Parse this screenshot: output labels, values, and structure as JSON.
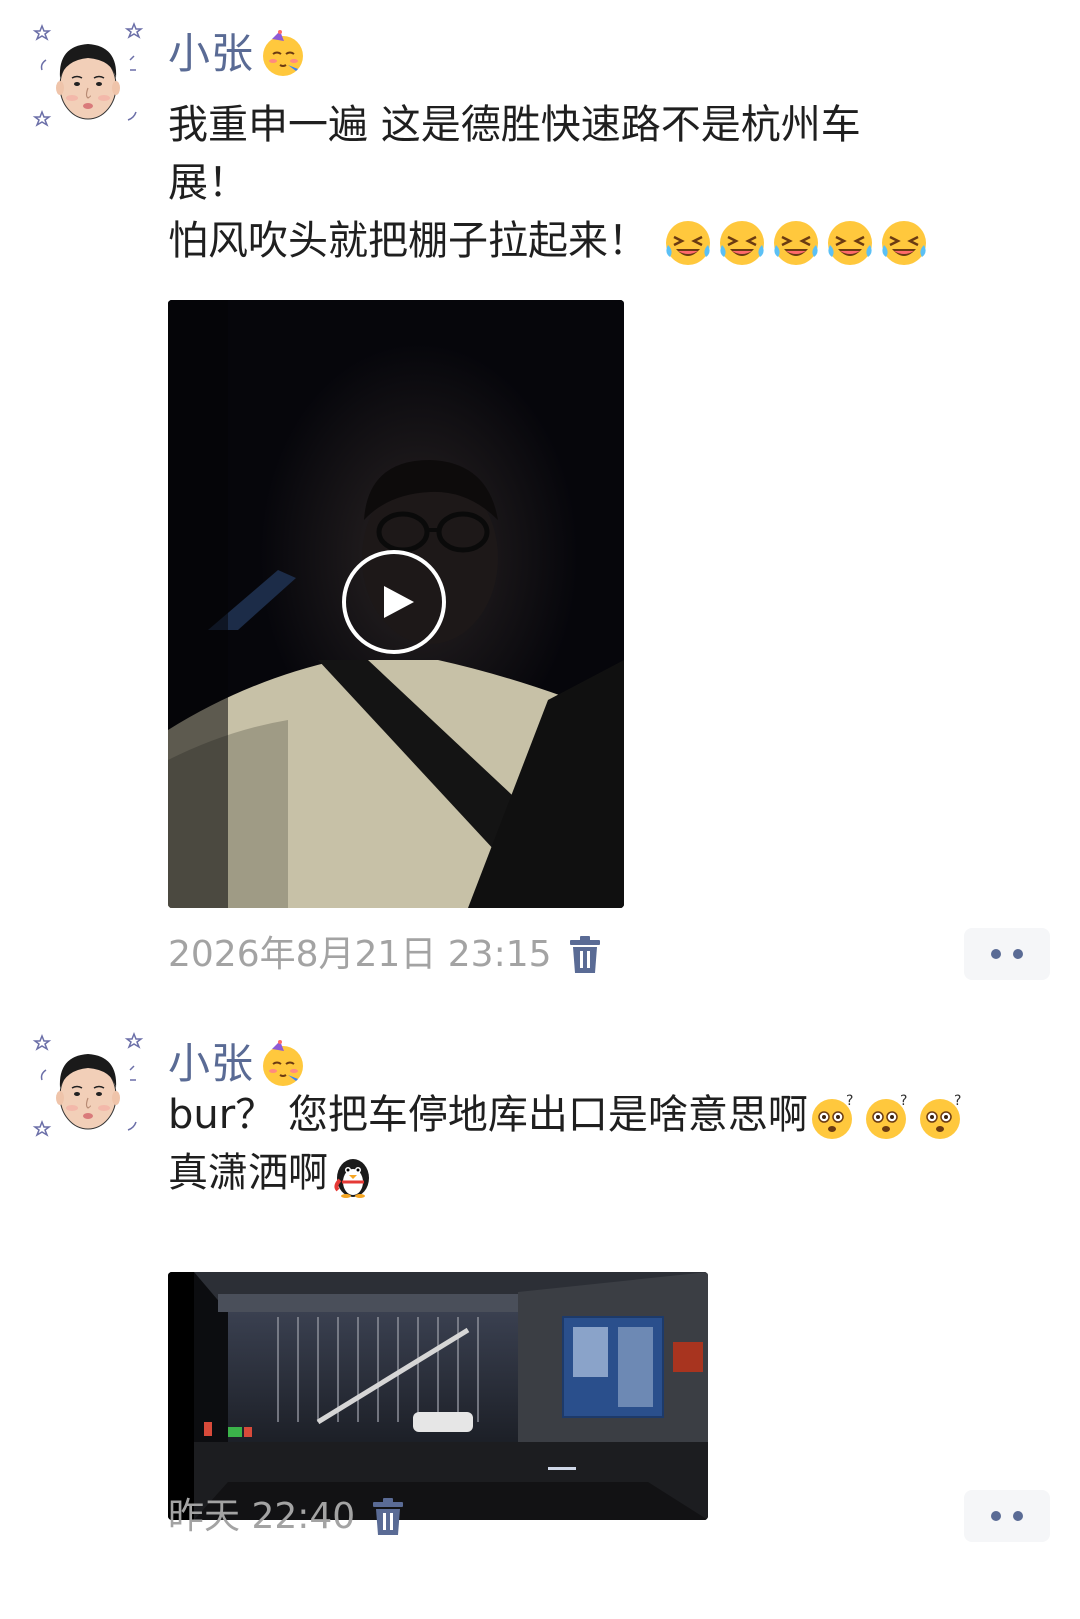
{
  "posts": [
    {
      "author": "小张",
      "author_emoji": "party-face-icon",
      "lines": [
        "我重申一遍 这是德胜快速路不是杭州车",
        "展！",
        "怕风吹头就把棚子拉起来！"
      ],
      "trailing_emojis": [
        "crying-laughing-icon",
        "crying-laughing-icon",
        "crying-laughing-icon",
        "crying-laughing-icon",
        "crying-laughing-icon"
      ],
      "media": {
        "type": "video",
        "icon": "play-icon"
      },
      "time": "2026年8月21日 23:15"
    },
    {
      "author": "小张",
      "author_emoji": "party-face-icon",
      "lines": [
        "bur？ 您把车停地库出口是啥意思啊",
        "真潇洒啊"
      ],
      "line1_emojis": [
        "confused-face-icon",
        "confused-face-icon",
        "confused-face-icon"
      ],
      "line2_emoji": "penguin-icon",
      "media": {
        "type": "photo",
        "subject": "dashcam-parking-exit"
      },
      "time": "昨天 22:40"
    }
  ],
  "colors": {
    "author_name": "#5a6b95",
    "timestamp": "#a3a3a3",
    "icon_accent": "#5a6b95",
    "more_button_bg": "#f5f6f8",
    "text": "#1f1f1f"
  }
}
